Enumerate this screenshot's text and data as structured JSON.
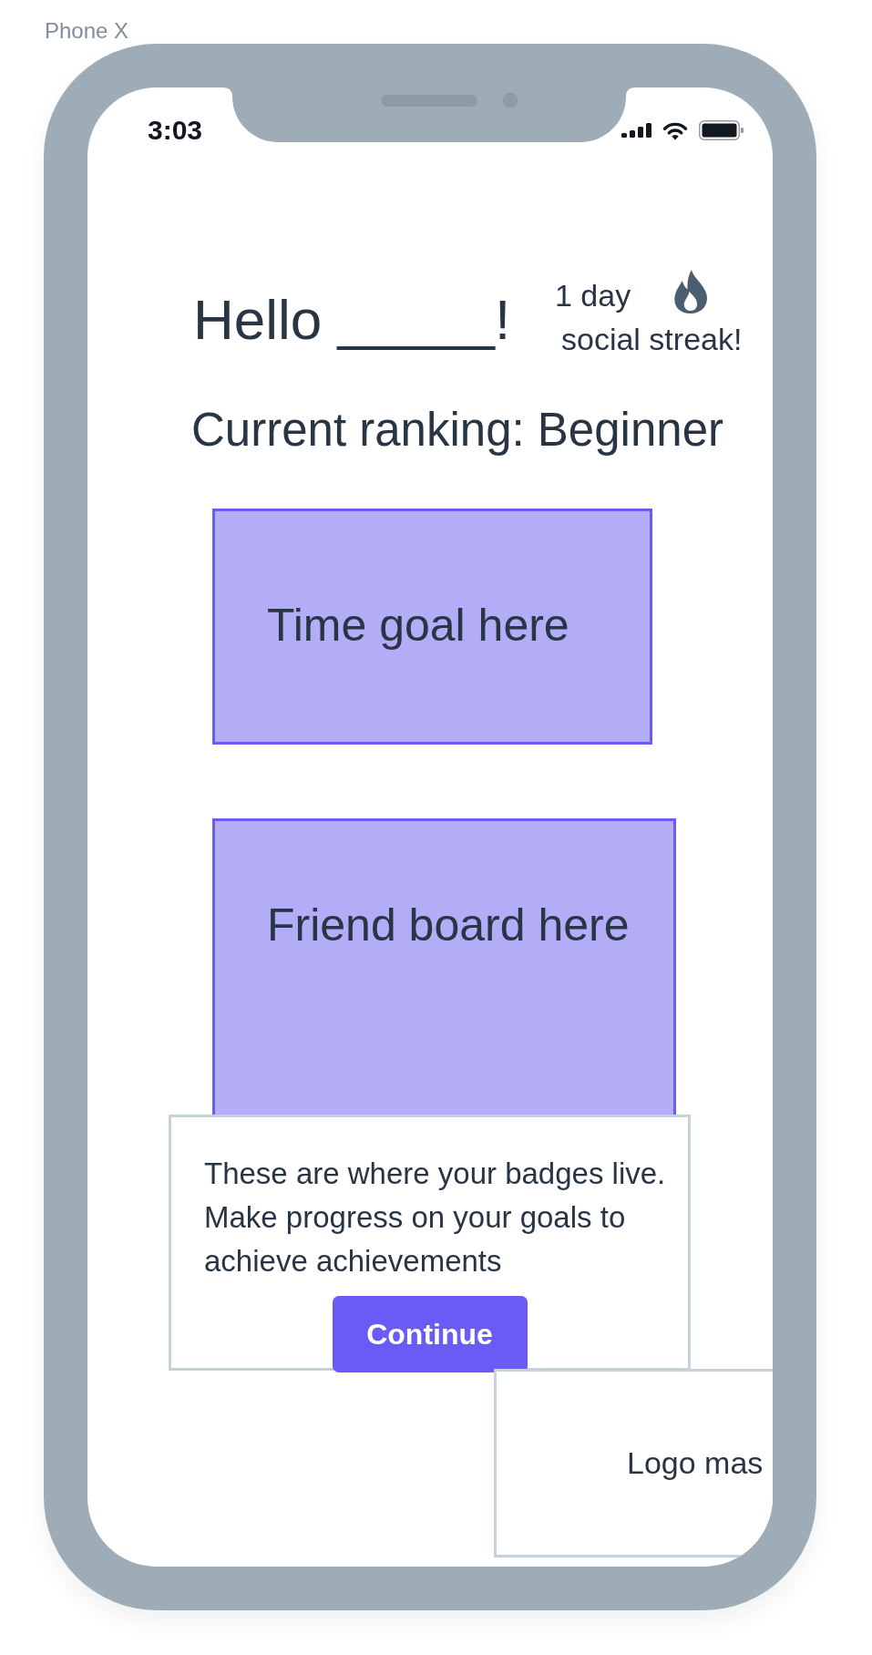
{
  "frame_label": "Phone X",
  "status_bar": {
    "time": "3:03"
  },
  "header": {
    "greeting": "Hello _____!",
    "streak": {
      "count": "1 day",
      "label": "social streak!"
    }
  },
  "ranking": "Current ranking: Beginner",
  "cards": [
    {
      "kind": "time_goal",
      "text": "Time goal here"
    },
    {
      "kind": "friend_board",
      "text": "Friend board here"
    }
  ],
  "tooltip": {
    "text": "These are where your badges live. Make progress on your goals to achieve achievements",
    "button": "Continue"
  },
  "logo_panel": {
    "text": "Logo mas"
  }
}
